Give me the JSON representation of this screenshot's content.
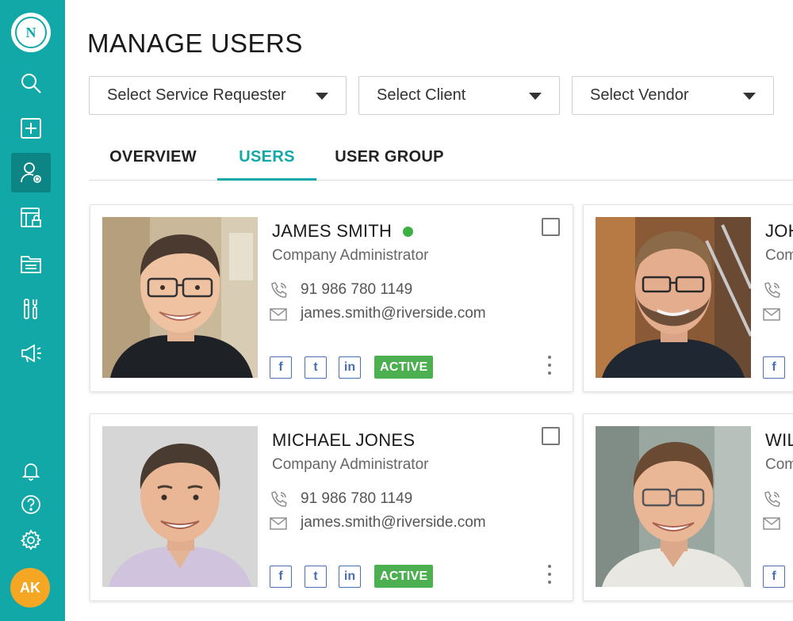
{
  "app": {
    "logo_letter": "N",
    "avatar_initials": "AK",
    "accent_color": "#12a8a8",
    "active_nav": "users-settings-icon"
  },
  "sidebar": {
    "top_icons": [
      "search-icon",
      "add-icon",
      "user-settings-icon",
      "secure-browser-icon",
      "folder-icon",
      "tools-icon",
      "megaphone-icon"
    ],
    "bottom_icons": [
      "bell-icon",
      "help-icon",
      "settings-icon"
    ]
  },
  "page": {
    "title": "MANAGE USERS"
  },
  "filters": {
    "service_requester": "Select Service Requester",
    "client": "Select Client",
    "vendor": "Select Vendor"
  },
  "tabs": [
    {
      "label": "OVERVIEW",
      "active": false
    },
    {
      "label": "USERS",
      "active": true
    },
    {
      "label": "USER GROUP",
      "active": false
    }
  ],
  "users": [
    {
      "name": "JAMES SMITH",
      "online": true,
      "role": "Company Administrator",
      "phone": "91 986 780 1149",
      "email": "james.smith@riverside.com",
      "status": "ACTIVE"
    },
    {
      "name": "MICHAEL JONES",
      "online": false,
      "role": "Company Administrator",
      "phone": "91 986 780 1149",
      "email": "james.smith@riverside.com",
      "status": "ACTIVE"
    },
    {
      "name": "JOH",
      "role": "Com"
    },
    {
      "name": "WIL",
      "role": "Com"
    }
  ],
  "social": {
    "facebook": "f",
    "twitter": "t",
    "linkedin": "in"
  }
}
